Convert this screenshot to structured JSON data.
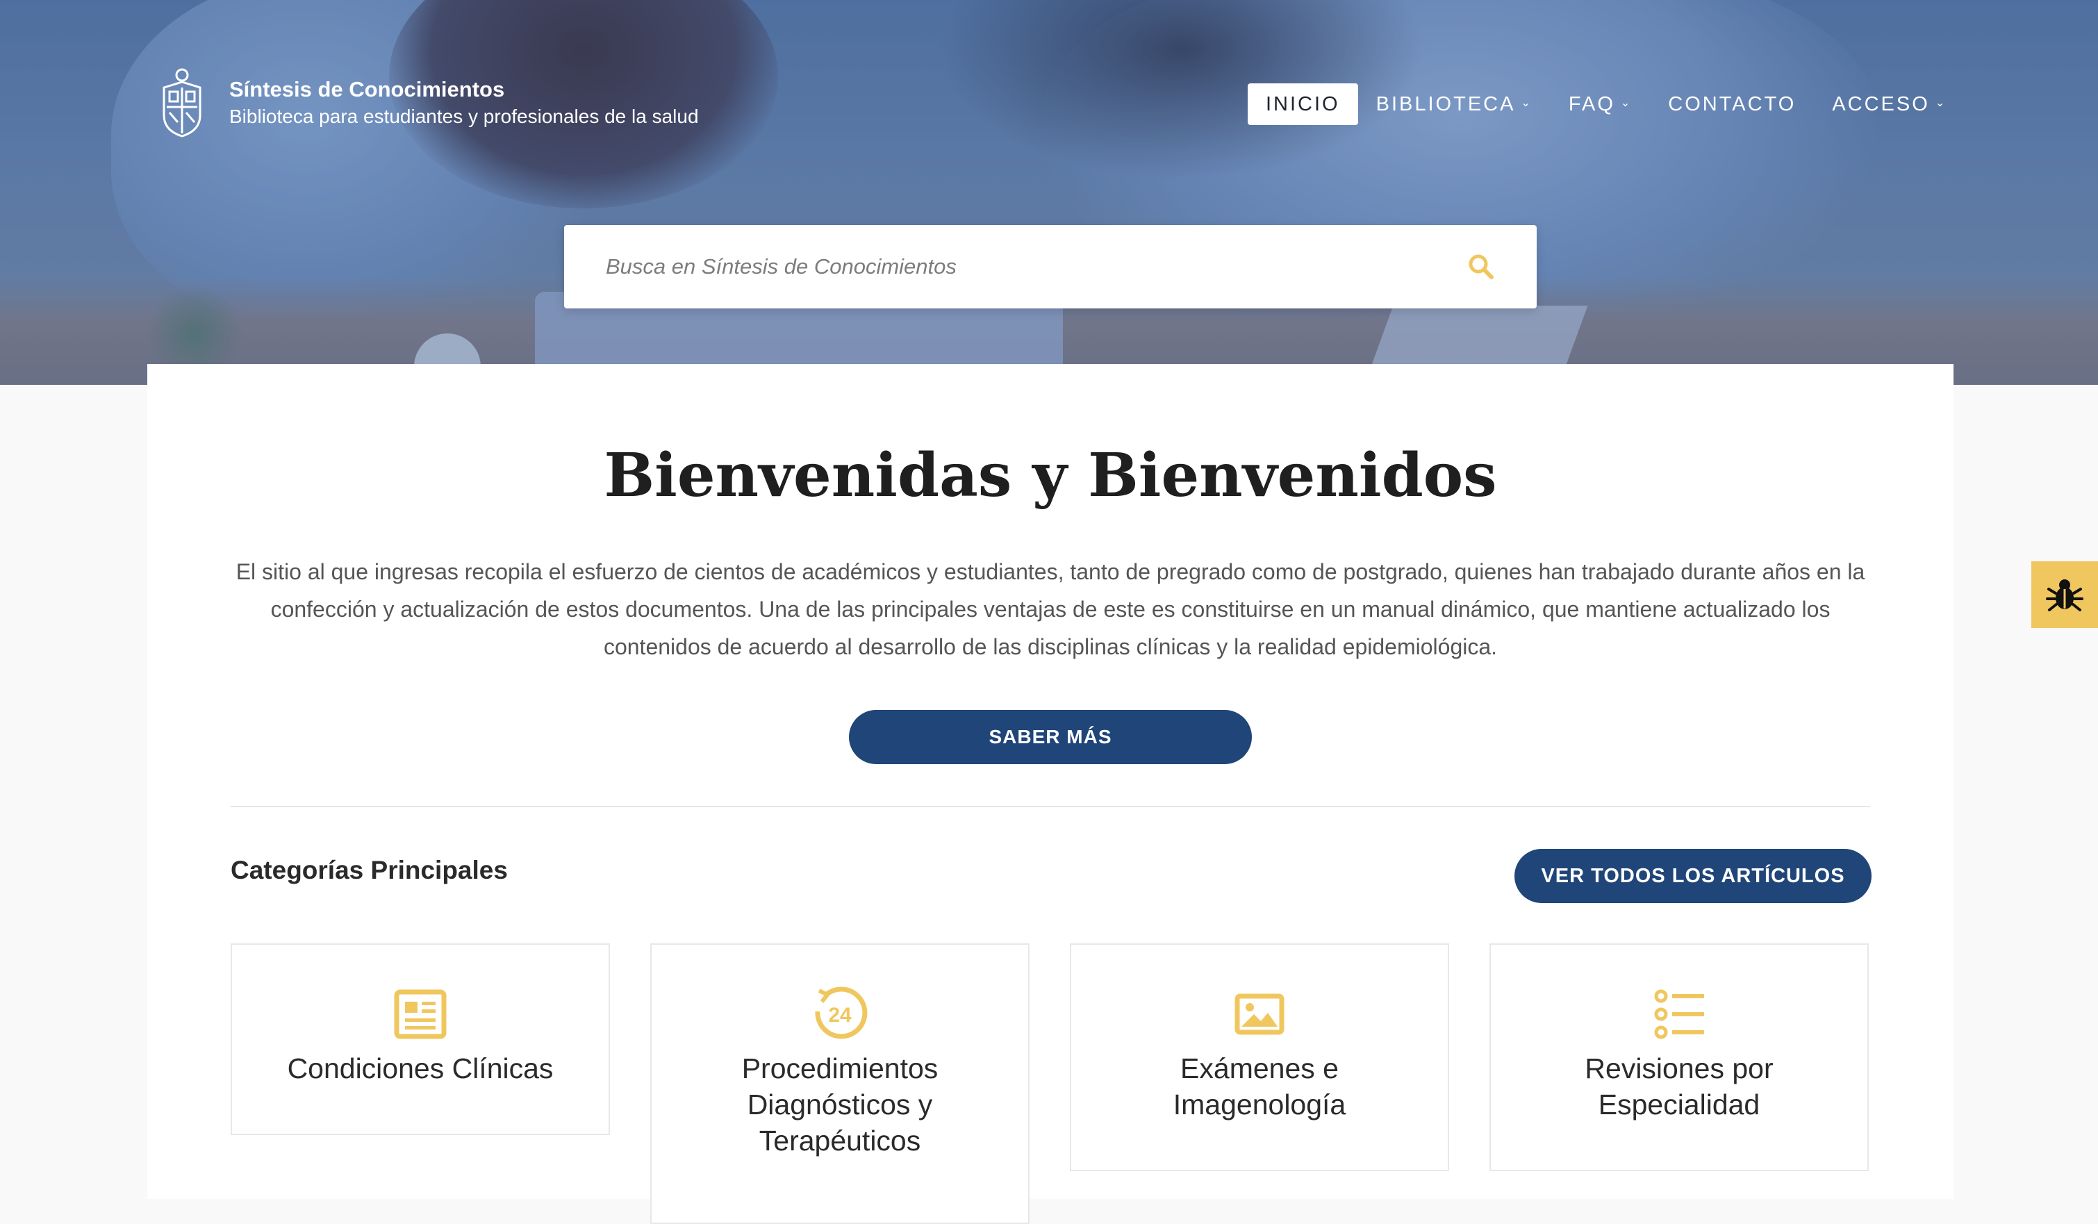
{
  "brand": {
    "title": "Síntesis de Conocimientos",
    "subtitle": "Biblioteca para estudiantes y profesionales de la salud",
    "logo_icon": "university-crest-icon"
  },
  "nav": {
    "items": [
      {
        "label": "INICIO",
        "active": true,
        "has_dropdown": false
      },
      {
        "label": "BIBLIOTECA",
        "active": false,
        "has_dropdown": true
      },
      {
        "label": "FAQ",
        "active": false,
        "has_dropdown": true
      },
      {
        "label": "CONTACTO",
        "active": false,
        "has_dropdown": false
      },
      {
        "label": "ACCESO",
        "active": false,
        "has_dropdown": true
      }
    ],
    "dropdown_icon": "chevron-down-icon"
  },
  "search": {
    "placeholder": "Busca en Síntesis de Conocimientos",
    "value": "",
    "icon": "search-icon"
  },
  "welcome": {
    "title": "Bienvenidas y Bienvenidos",
    "text": "El sitio al que ingresas recopila el esfuerzo de cientos de académicos y estudiantes, tanto de pregrado como de postgrado, quienes han trabajado durante años en la confección y actualización de estos documentos. Una de las principales ventajas de este es constituirse en un manual dinámico, que mantiene actualizado los contenidos de acuerdo al desarrollo de las disciplinas clínicas y la realidad epidemiológica.",
    "button_label": "SABER MÁS"
  },
  "categories": {
    "heading": "Categorías Principales",
    "all_button_label": "VER TODOS LOS ARTÍCULOS",
    "items": [
      {
        "label": "Condiciones Clínicas",
        "icon": "newspaper-icon"
      },
      {
        "label": "Procedimientos Diagnósticos y Terapéuticos",
        "icon": "24-hours-icon"
      },
      {
        "label": "Exámenes e Imagenología",
        "icon": "image-icon"
      },
      {
        "label": "Revisiones por Especialidad",
        "icon": "list-icon"
      }
    ]
  },
  "accessibility": {
    "icon": "bug-icon"
  },
  "colors": {
    "accent": "#f0c75e",
    "primary_button": "#1f4579",
    "page_background": "#f9f9f9"
  }
}
